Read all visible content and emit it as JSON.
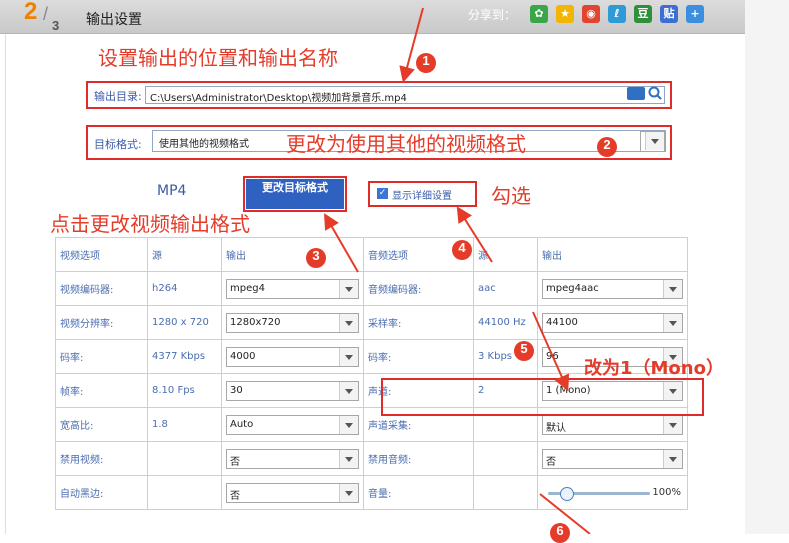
{
  "header": {
    "step_number": "2",
    "step_slash": "/",
    "step_total": "3",
    "title": "输出设置",
    "share_label": "分享到：",
    "share_icons": [
      "wechat-icon",
      "qzone-icon",
      "weibo-icon",
      "tencent-icon",
      "douban-icon",
      "tieba-icon",
      "more-share-icon"
    ]
  },
  "annotations": {
    "a1": "设置输出的位置和输出名称",
    "a2": "更改为使用其他的视频格式",
    "a3": "点击更改视频输出格式",
    "a4": "勾选",
    "a5": "改为1（Mono）",
    "badges": [
      "1",
      "2",
      "3",
      "4",
      "5",
      "6"
    ]
  },
  "output": {
    "dir_label": "输出目录:",
    "dir_value": "C:\\Users\\Administrator\\Desktop\\视频加背景音乐.mp4",
    "format_label": "目标格式:",
    "format_value": "使用其他的视频格式",
    "format_name": "MP4",
    "change_button": "更改目标格式",
    "detail_checkbox": "显示详细设置",
    "detail_checked": true
  },
  "table": {
    "video_header": [
      "视频选项",
      "源",
      "输出"
    ],
    "audio_header": [
      "音频选项",
      "源",
      "输出"
    ],
    "video_rows": [
      {
        "label": "视频编码器:",
        "src": "h264",
        "out": "mpeg4"
      },
      {
        "label": "视频分辨率:",
        "src": "1280 x 720",
        "out": "1280x720"
      },
      {
        "label": "码率:",
        "src": "4377 Kbps",
        "out": "4000"
      },
      {
        "label": "帧率:",
        "src": "8.10 Fps",
        "out": "30"
      },
      {
        "label": "宽高比:",
        "src": "1.8",
        "out": "Auto"
      },
      {
        "label": "禁用视频:",
        "src": "",
        "out": "否"
      },
      {
        "label": "自动黑边:",
        "src": "",
        "out": "否"
      }
    ],
    "audio_rows": [
      {
        "label": "音频编码器:",
        "src": "aac",
        "out": "mpeg4aac"
      },
      {
        "label": "采样率:",
        "src": "44100 Hz",
        "out": "44100"
      },
      {
        "label": "码率:",
        "src": "3 Kbps",
        "out": "96"
      },
      {
        "label": "声道:",
        "src": "2",
        "out": "1 (Mono)"
      },
      {
        "label": "声道采集:",
        "src": "",
        "out": "默认"
      },
      {
        "label": "禁用音频:",
        "src": "",
        "out": "否"
      },
      {
        "label": "音量:",
        "src": "",
        "out": "100%"
      }
    ],
    "volume_fraction": 0.18
  },
  "colors": {
    "accent_red": "#e53c2a",
    "header_gray": "#cfcfcf",
    "link_blue": "#3a5ba8"
  }
}
